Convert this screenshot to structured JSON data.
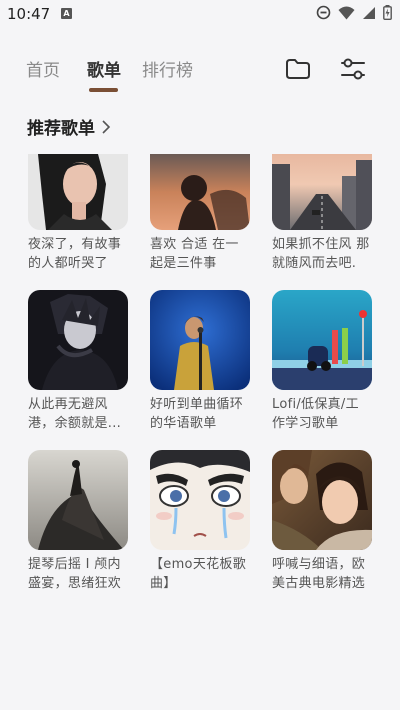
{
  "status_bar": {
    "time": "10:47",
    "icons": [
      "notification-a-icon",
      "dnd-icon",
      "wifi-icon",
      "signal-icon",
      "battery-charging-icon"
    ]
  },
  "tabs": [
    {
      "label": "首页",
      "active": false
    },
    {
      "label": "歌单",
      "active": true
    },
    {
      "label": "排行榜",
      "active": false
    }
  ],
  "actions": {
    "folder_icon": "folder-icon",
    "filter_icon": "sliders-icon"
  },
  "section": {
    "title": "推荐歌单",
    "chevron": "chevron-right-icon"
  },
  "playlists": [
    {
      "title": "夜深了，有故事的人都听哭了"
    },
    {
      "title": "喜欢 合适 在一起是三件事"
    },
    {
      "title": "如果抓不住风 那就随风而去吧."
    },
    {
      "title": "从此再无避风港，余额就是..."
    },
    {
      "title": "好听到单曲循环的华语歌单"
    },
    {
      "title": "Lofi/低保真/工作学习歌单"
    },
    {
      "title": "提琴后摇 I 颅内盛宴，思绪狂欢"
    },
    {
      "title": "【emo天花板歌曲】"
    },
    {
      "title": "呼喊与细语，欧美古典电影精选"
    }
  ],
  "colors": {
    "accent": "#7a4f35",
    "background": "#f5f5f7"
  }
}
